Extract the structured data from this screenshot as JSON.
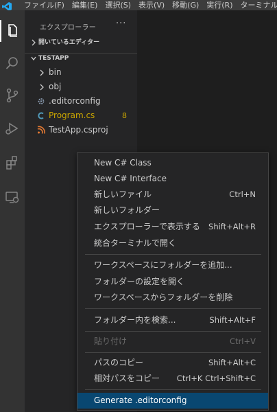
{
  "menubar": {
    "items": [
      "ファイル(F)",
      "編集(E)",
      "選択(S)",
      "表示(V)",
      "移動(G)",
      "実行(R)",
      "ターミナル"
    ]
  },
  "activity_bar": {
    "items": [
      "files-icon",
      "search-icon",
      "source-control-icon",
      "run-debug-icon",
      "extensions-icon",
      "remote-explorer-icon"
    ],
    "active": "files-icon"
  },
  "explorer": {
    "title": "エクスプローラー",
    "more": "···",
    "open_editors": "開いているエディター",
    "project": "TESTAPP",
    "items": [
      {
        "name": "bin",
        "kind": "folder"
      },
      {
        "name": "obj",
        "kind": "folder"
      },
      {
        "name": ".editorconfig",
        "kind": "config"
      },
      {
        "name": "Program.cs",
        "kind": "csharp",
        "badge": "8"
      },
      {
        "name": "TestApp.csproj",
        "kind": "rss"
      }
    ]
  },
  "context_menu": {
    "groups": [
      [
        {
          "label": "New C# Class",
          "key": ""
        },
        {
          "label": "New C# Interface",
          "key": ""
        },
        {
          "label": "新しいファイル",
          "key": "Ctrl+N"
        },
        {
          "label": "新しいフォルダー",
          "key": ""
        },
        {
          "label": "エクスプローラーで表示する",
          "key": "Shift+Alt+R"
        },
        {
          "label": "統合ターミナルで開く",
          "key": ""
        }
      ],
      [
        {
          "label": "ワークスペースにフォルダーを追加...",
          "key": ""
        },
        {
          "label": "フォルダーの設定を開く",
          "key": ""
        },
        {
          "label": "ワークスペースからフォルダーを削除",
          "key": ""
        }
      ],
      [
        {
          "label": "フォルダー内を検索...",
          "key": "Shift+Alt+F"
        }
      ],
      [
        {
          "label": "貼り付け",
          "key": "Ctrl+V",
          "disabled": true
        }
      ],
      [
        {
          "label": "パスのコピー",
          "key": "Shift+Alt+C"
        },
        {
          "label": "相対パスをコピー",
          "key": "Ctrl+K Ctrl+Shift+C"
        }
      ],
      [
        {
          "label": "Generate .editorconfig",
          "key": "",
          "selected": true
        }
      ]
    ]
  },
  "colors": {
    "accent_selected": "#094771",
    "warning": "#cca700",
    "csharp": "#519aba",
    "rss": "#e37933"
  }
}
